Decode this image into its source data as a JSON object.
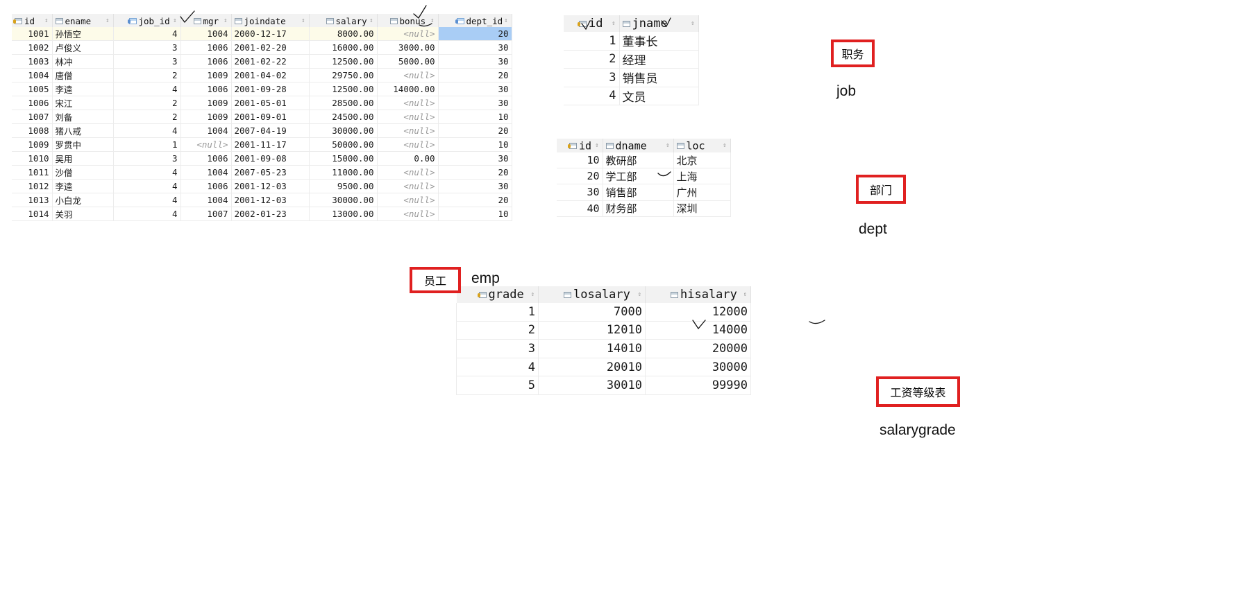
{
  "emp": {
    "columns": [
      "id",
      "ename",
      "job_id",
      "mgr",
      "joindate",
      "salary",
      "bonus",
      "dept_id"
    ],
    "rows": [
      [
        "1001",
        "孙悟空",
        "4",
        "1004",
        "2000-12-17",
        "8000.00",
        "<null>",
        "20"
      ],
      [
        "1002",
        "卢俊义",
        "3",
        "1006",
        "2001-02-20",
        "16000.00",
        "3000.00",
        "30"
      ],
      [
        "1003",
        "林冲",
        "3",
        "1006",
        "2001-02-22",
        "12500.00",
        "5000.00",
        "30"
      ],
      [
        "1004",
        "唐僧",
        "2",
        "1009",
        "2001-04-02",
        "29750.00",
        "<null>",
        "20"
      ],
      [
        "1005",
        "李逵",
        "4",
        "1006",
        "2001-09-28",
        "12500.00",
        "14000.00",
        "30"
      ],
      [
        "1006",
        "宋江",
        "2",
        "1009",
        "2001-05-01",
        "28500.00",
        "<null>",
        "30"
      ],
      [
        "1007",
        "刘备",
        "2",
        "1009",
        "2001-09-01",
        "24500.00",
        "<null>",
        "10"
      ],
      [
        "1008",
        "猪八戒",
        "4",
        "1004",
        "2007-04-19",
        "30000.00",
        "<null>",
        "20"
      ],
      [
        "1009",
        "罗贯中",
        "1",
        "<null>",
        "2001-11-17",
        "50000.00",
        "<null>",
        "10"
      ],
      [
        "1010",
        "吴用",
        "3",
        "1006",
        "2001-09-08",
        "15000.00",
        "0.00",
        "30"
      ],
      [
        "1011",
        "沙僧",
        "4",
        "1004",
        "2007-05-23",
        "11000.00",
        "<null>",
        "20"
      ],
      [
        "1012",
        "李逵",
        "4",
        "1006",
        "2001-12-03",
        "9500.00",
        "<null>",
        "30"
      ],
      [
        "1013",
        "小白龙",
        "4",
        "1004",
        "2001-12-03",
        "30000.00",
        "<null>",
        "20"
      ],
      [
        "1014",
        "关羽",
        "4",
        "1007",
        "2002-01-23",
        "13000.00",
        "<null>",
        "10"
      ]
    ],
    "label_cn": "员工",
    "label_en": "emp"
  },
  "job": {
    "columns": [
      "id",
      "jname"
    ],
    "rows": [
      [
        "1",
        "董事长"
      ],
      [
        "2",
        "经理"
      ],
      [
        "3",
        "销售员"
      ],
      [
        "4",
        "文员"
      ]
    ],
    "label_cn": "职务",
    "label_en": "job"
  },
  "dept": {
    "columns": [
      "id",
      "dname",
      "loc"
    ],
    "rows": [
      [
        "10",
        "教研部",
        "北京"
      ],
      [
        "20",
        "学工部",
        "上海"
      ],
      [
        "30",
        "销售部",
        "广州"
      ],
      [
        "40",
        "财务部",
        "深圳"
      ]
    ],
    "label_cn": "部门",
    "label_en": "dept"
  },
  "salarygrade": {
    "columns": [
      "grade",
      "losalary",
      "hisalary"
    ],
    "rows": [
      [
        "1",
        "7000",
        "12000"
      ],
      [
        "2",
        "12010",
        "14000"
      ],
      [
        "3",
        "14010",
        "20000"
      ],
      [
        "4",
        "20010",
        "30000"
      ],
      [
        "5",
        "30010",
        "99990"
      ]
    ],
    "label_cn": "工资等级表",
    "label_en": "salarygrade"
  },
  "colors": {
    "highlight_box": "#e02020",
    "selected_cell": "#a9cdf5"
  }
}
